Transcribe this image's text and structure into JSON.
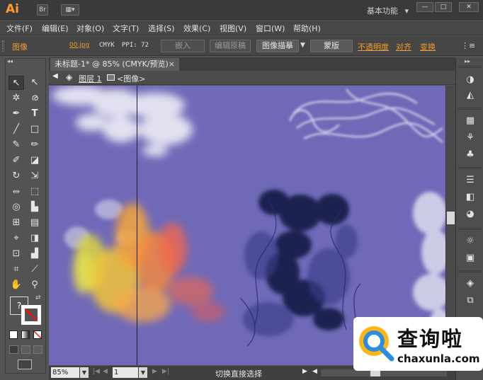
{
  "app": {
    "logo": "Ai",
    "workspace": "基本功能",
    "workspace_arrow": "▾"
  },
  "titlebar": {
    "bridge_label": "Br",
    "arrange_icon": "arrange-documents-icon"
  },
  "window_controls": {
    "minimize": "—",
    "maximize": "□",
    "close": "✕"
  },
  "menu": [
    "文件(F)",
    "编辑(E)",
    "对象(O)",
    "文字(T)",
    "选择(S)",
    "效果(C)",
    "视图(V)",
    "窗口(W)",
    "帮助(H)"
  ],
  "control": {
    "type_label": "图像",
    "filename": "00.jpg",
    "color_mode": "CMYK",
    "ppi": "PPI: 72",
    "embed": "嵌入",
    "edit_original": "编辑原稿",
    "image_trace": "图像描摹",
    "mask": "蒙版",
    "opacity": "不透明度",
    "align": "对齐",
    "transform": "变换",
    "menu_icon": "panel-menu-icon"
  },
  "document": {
    "tab_title": "未标题-1* @ 85% (CMYK/预览)",
    "close": "×"
  },
  "breadcrumb": {
    "layer": "图层 1",
    "item": "<图像>"
  },
  "status": {
    "zoom": "85%",
    "page": "1",
    "tool_text": "切换直接选择"
  },
  "watermark": {
    "cn": "查询啦",
    "en": "chaxunla.com"
  },
  "colors": {
    "accent": "#f39a2e",
    "canvas": "#6f69b8",
    "chrome": "#535353"
  }
}
